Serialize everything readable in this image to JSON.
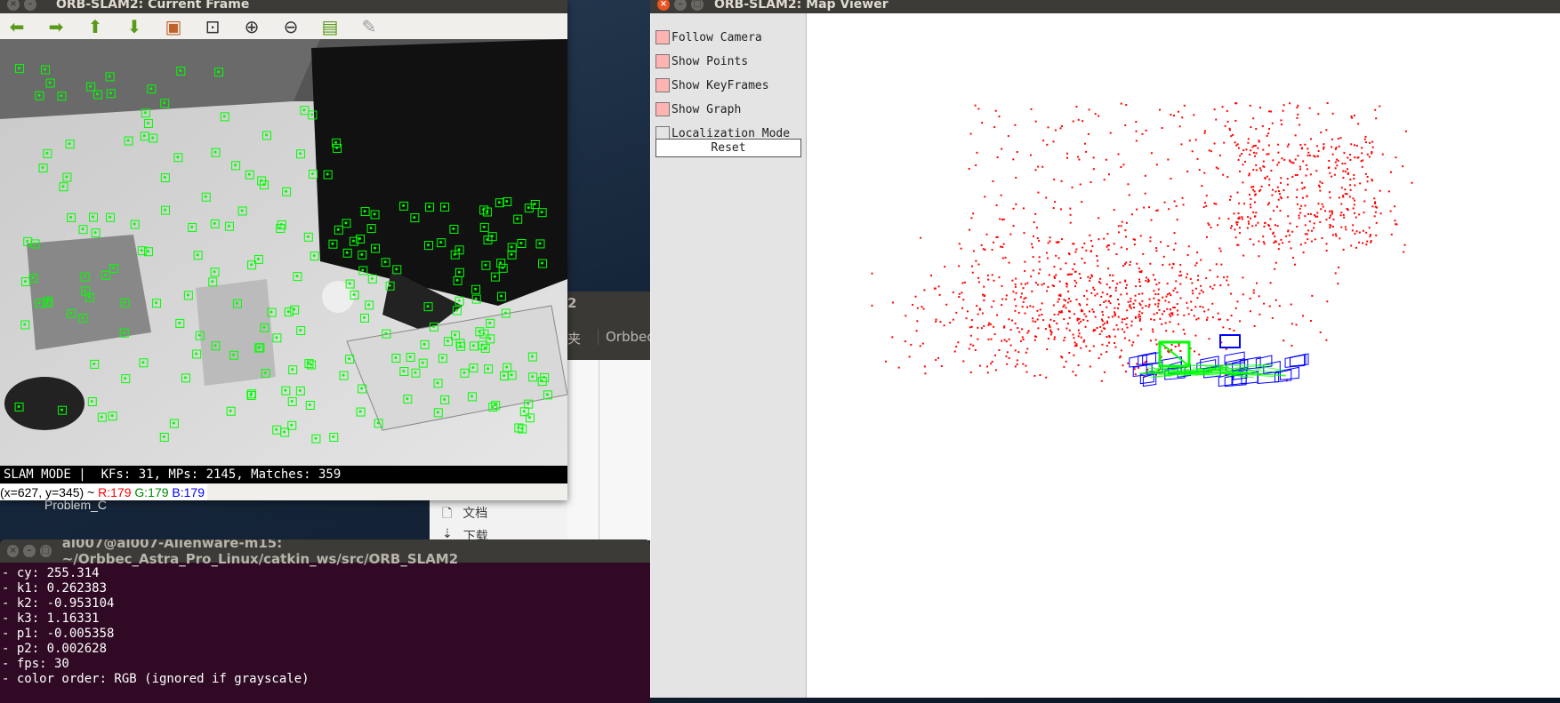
{
  "current_frame": {
    "title": "ORB-SLAM2: Current Frame",
    "toolbar": [
      {
        "icon": "arrow-left-icon",
        "glyph": "⬅"
      },
      {
        "icon": "arrow-right-icon",
        "glyph": "➡"
      },
      {
        "icon": "arrow-up-icon",
        "glyph": "⬆"
      },
      {
        "icon": "arrow-down-icon",
        "glyph": "⬇"
      },
      {
        "icon": "image-icon",
        "glyph": "▣"
      },
      {
        "icon": "zoom-fit-icon",
        "glyph": "⊡"
      },
      {
        "icon": "zoom-in-icon",
        "glyph": "⊕"
      },
      {
        "icon": "zoom-out-icon",
        "glyph": "⊖"
      },
      {
        "icon": "save-icon",
        "glyph": "▤"
      },
      {
        "icon": "clear-brush-icon",
        "glyph": "✎"
      }
    ],
    "status": "SLAM MODE |  KFs: 31, MPs: 2145, Matches: 359",
    "pixel_info": {
      "coords": "(x=627, y=345) ~ ",
      "r": "R:179",
      "g": "G:179",
      "b": "B:179"
    },
    "feature_color": "#00ff00"
  },
  "desktop": {
    "icon_label": "Problem_C"
  },
  "file_manager": {
    "title_fragment": "2",
    "tabs": [
      "夹",
      "Orbbec_"
    ],
    "sidebar": [
      {
        "icon": "document-icon",
        "label": "文档"
      },
      {
        "icon": "download-icon",
        "label": "下载"
      }
    ]
  },
  "terminal": {
    "title": "al007@al007-Alienware-m15: ~/Orbbec_Astra_Pro_Linux/catkin_ws/src/ORB_SLAM2",
    "lines": [
      "- cy: 255.314",
      "- k1: 0.262383",
      "- k2: -0.953104",
      "- k3: 1.16331",
      "- p1: -0.005358",
      "- p2: 0.002628",
      "- fps: 30",
      "- color order: RGB (ignored if grayscale)"
    ]
  },
  "map_viewer": {
    "title": "ORB-SLAM2: Map Viewer",
    "options": [
      {
        "label": "Follow Camera",
        "checked": true
      },
      {
        "label": "Show Points",
        "checked": true
      },
      {
        "label": "Show KeyFrames",
        "checked": true
      },
      {
        "label": "Show Graph",
        "checked": true
      },
      {
        "label": "Localization Mode",
        "checked": false
      }
    ],
    "reset_label": "Reset",
    "colors": {
      "map_points": "#ff0000",
      "keyframes": "#0000ff",
      "graph": "#00ff00",
      "checked": "#ffb3b3"
    }
  }
}
